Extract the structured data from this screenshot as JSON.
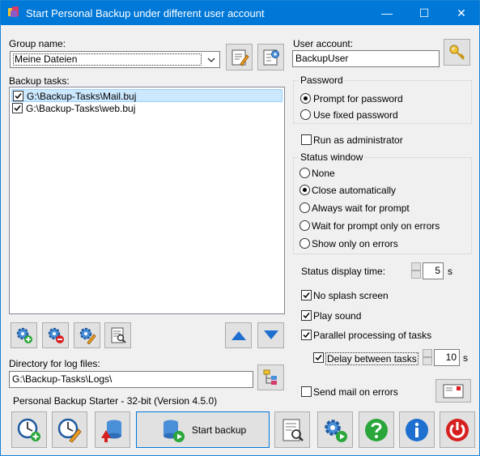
{
  "window": {
    "title": "Start Personal Backup under different user account",
    "minimize": "—",
    "maximize": "☐",
    "close": "✕"
  },
  "group": {
    "label": "Group name:",
    "value": "Meine Dateien"
  },
  "tasks": {
    "label": "Backup tasks:",
    "items": [
      {
        "path": "G:\\Backup-Tasks\\Mail.buj",
        "checked": true,
        "selected": true
      },
      {
        "path": "G:\\Backup-Tasks\\web.buj",
        "checked": true,
        "selected": false
      }
    ]
  },
  "log": {
    "label": "Directory for log files:",
    "value": "G:\\Backup-Tasks\\Logs\\"
  },
  "user": {
    "label": "User account:",
    "value": "BackupUser"
  },
  "password": {
    "title": "Password",
    "options": [
      "Prompt for password",
      "Use fixed password"
    ],
    "selected": 0
  },
  "run_as_admin": {
    "label": "Run as administrator",
    "checked": false
  },
  "status_window": {
    "title": "Status window",
    "options": [
      "None",
      "Close automatically",
      "Always wait for prompt",
      "Wait for prompt only on errors",
      "Show only on errors"
    ],
    "selected": 1
  },
  "status_time": {
    "label": "Status display time:",
    "value": "5",
    "unit": "s"
  },
  "options": {
    "no_splash": {
      "label": "No splash screen",
      "checked": true
    },
    "play_sound": {
      "label": "Play sound",
      "checked": true
    },
    "parallel": {
      "label": "Parallel processing of tasks",
      "checked": true
    },
    "delay": {
      "label": "Delay between tasks",
      "checked": true,
      "value": "10",
      "unit": "s"
    },
    "send_mail": {
      "label": "Send mail on errors",
      "checked": false
    }
  },
  "footer": {
    "version": "Personal Backup Starter - 32-bit (Version 4.5.0)",
    "start_label": "Start backup"
  },
  "colors": {
    "titlebar": "#0078d7",
    "selection": "#cce8ff",
    "accent_blue": "#1e6fd0",
    "help_green": "#2aa63a",
    "power_red": "#d62020"
  }
}
